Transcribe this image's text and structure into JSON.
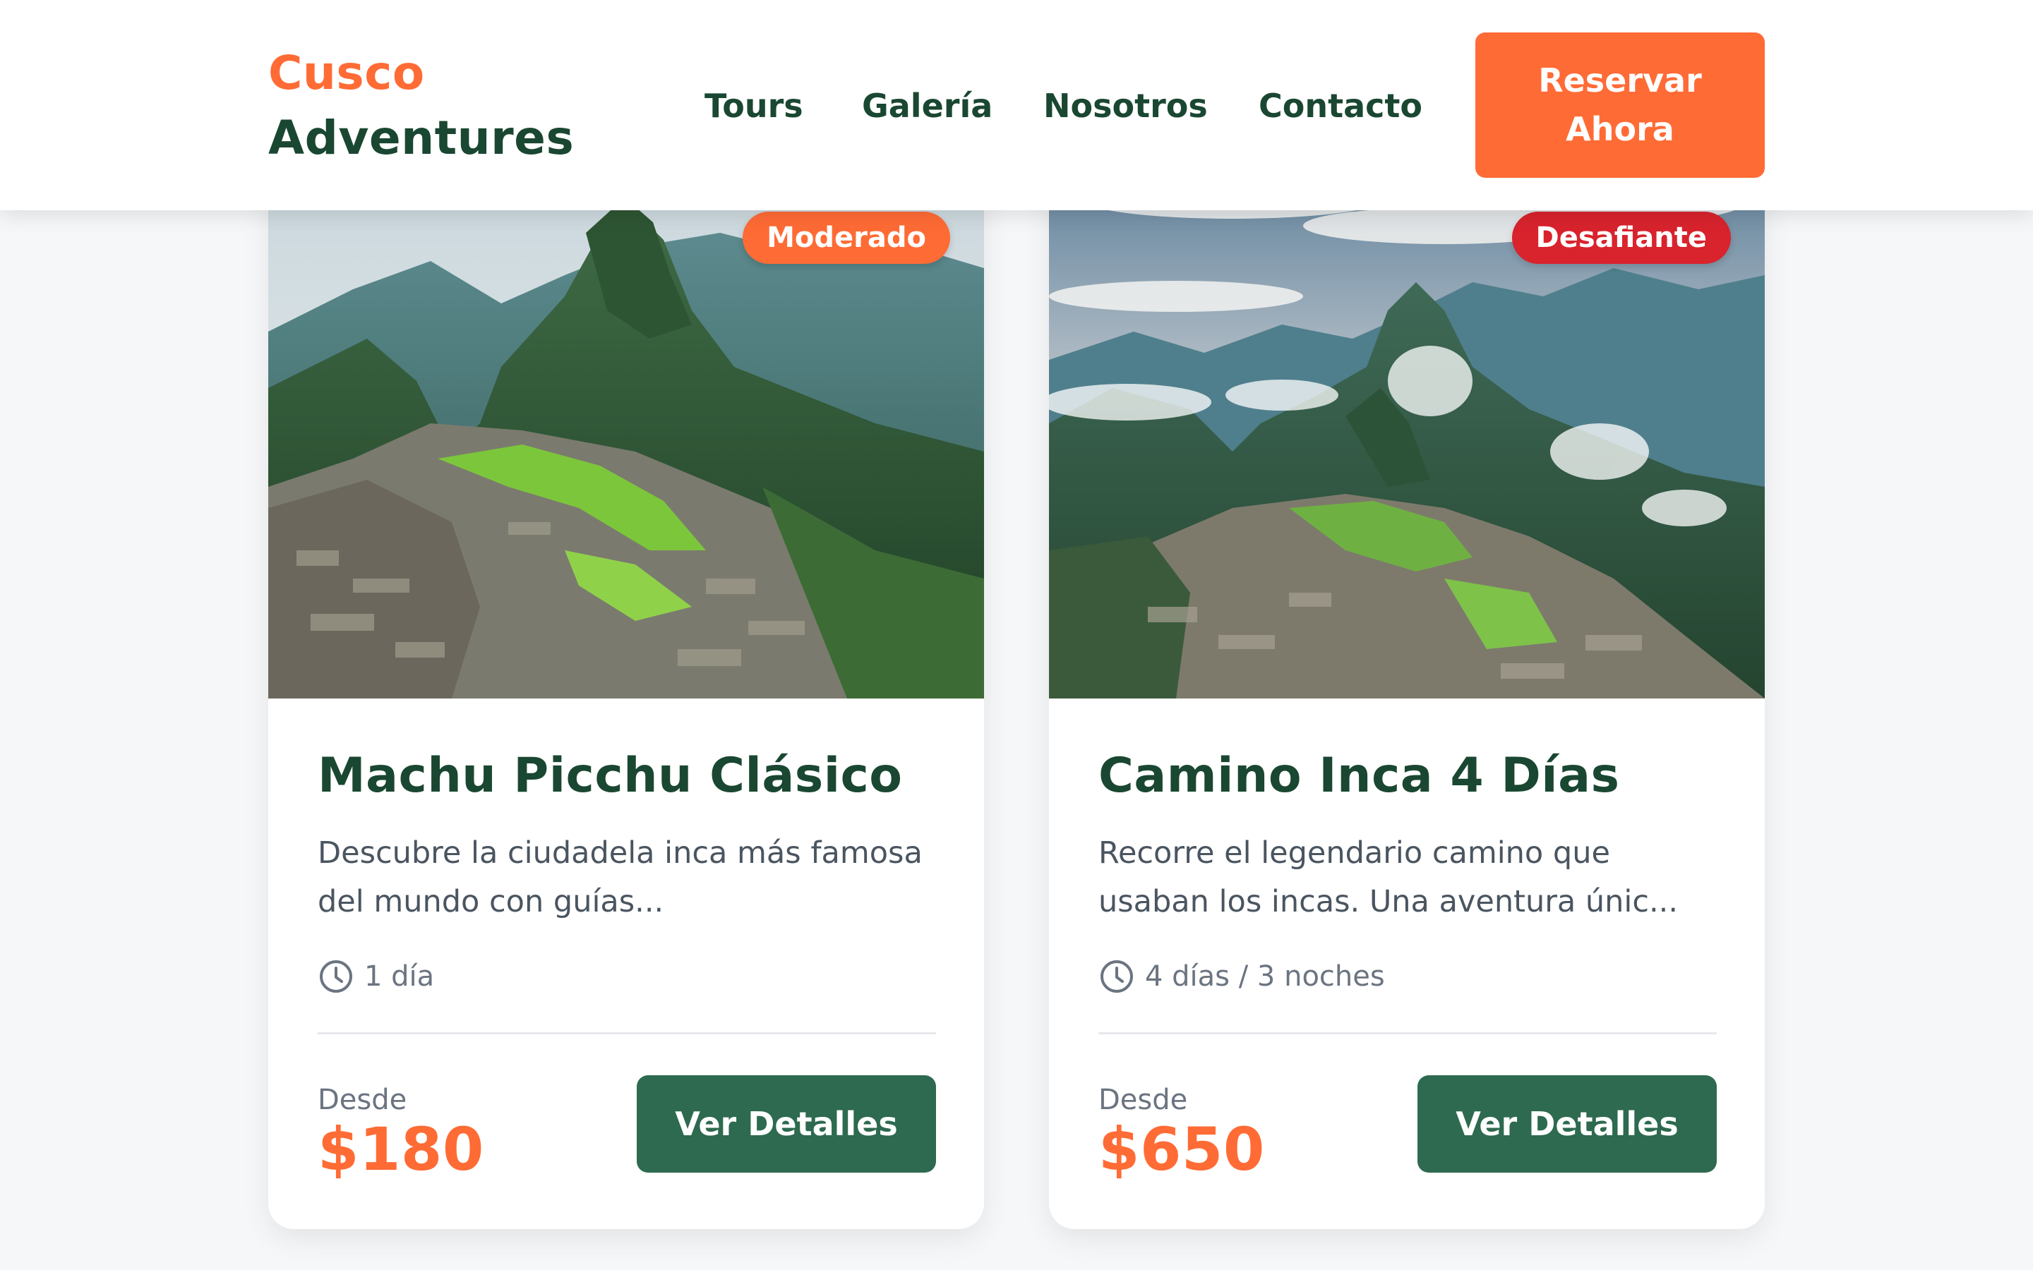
{
  "header": {
    "brand_line1": "Cusco",
    "brand_line2": "Adventures",
    "nav": [
      "Tours",
      "Galería",
      "Nosotros",
      "Contacto"
    ],
    "cta": "Reservar\nAhora"
  },
  "colors": {
    "accent": "#ff6b35",
    "brand_green": "#1a4731",
    "button_green": "#2d6a4f",
    "badge_hard": "#d9232d"
  },
  "tours": [
    {
      "badge": "Moderado",
      "title": "Machu Picchu Clásico",
      "description": "Descubre la ciudadela inca más famosa del mundo con guías...",
      "duration_icon": "clock-icon",
      "duration": "1 día",
      "from_label": "Desde",
      "price": "$180",
      "button": "Ver Detalles"
    },
    {
      "badge": "Desafiante",
      "title": "Camino Inca 4 Días",
      "description": "Recorre el legendario camino que usaban los incas. Una aventura únic...",
      "duration_icon": "clock-icon",
      "duration": "4 días / 3 noches",
      "from_label": "Desde",
      "price": "$650",
      "button": "Ver Detalles"
    }
  ]
}
